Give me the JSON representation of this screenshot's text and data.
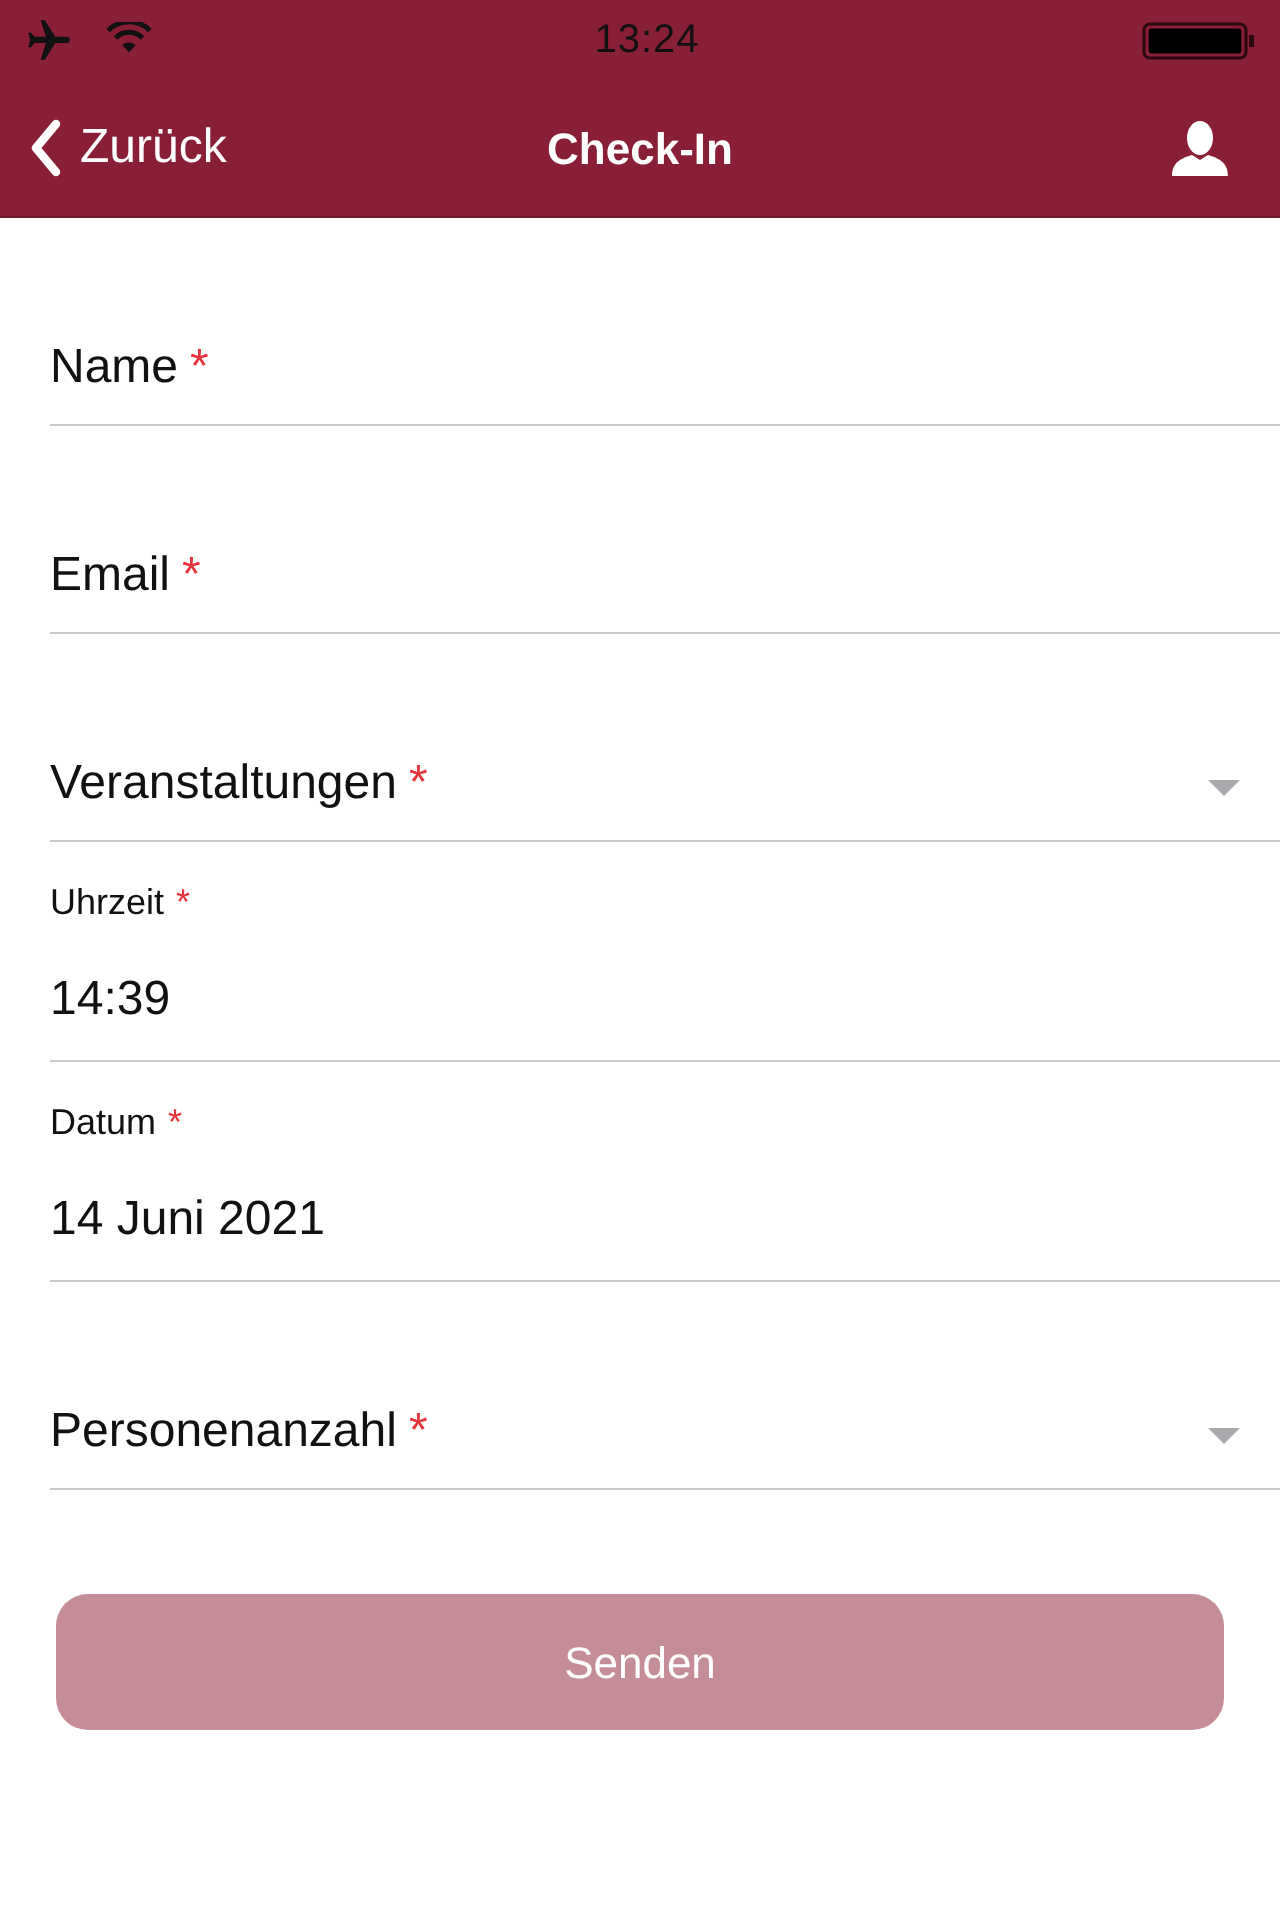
{
  "status_bar": {
    "time": "13:24"
  },
  "nav": {
    "back_label": "Zurück",
    "title": "Check-In"
  },
  "fields": [
    {
      "kind": "text",
      "label": "Name",
      "required_mark": "*"
    },
    {
      "kind": "text",
      "label": "Email",
      "required_mark": "*"
    },
    {
      "kind": "select",
      "label": "Veranstaltungen",
      "required_mark": "*"
    },
    {
      "kind": "text",
      "label": "Uhrzeit",
      "required_mark": "*",
      "value": "14:39"
    },
    {
      "kind": "text",
      "label": "Datum",
      "required_mark": "*",
      "value": "14 Juni 2021"
    },
    {
      "kind": "select",
      "label": "Personenanzahl",
      "required_mark": "*"
    }
  ],
  "submit": {
    "label": "Senden",
    "disabled": true
  }
}
